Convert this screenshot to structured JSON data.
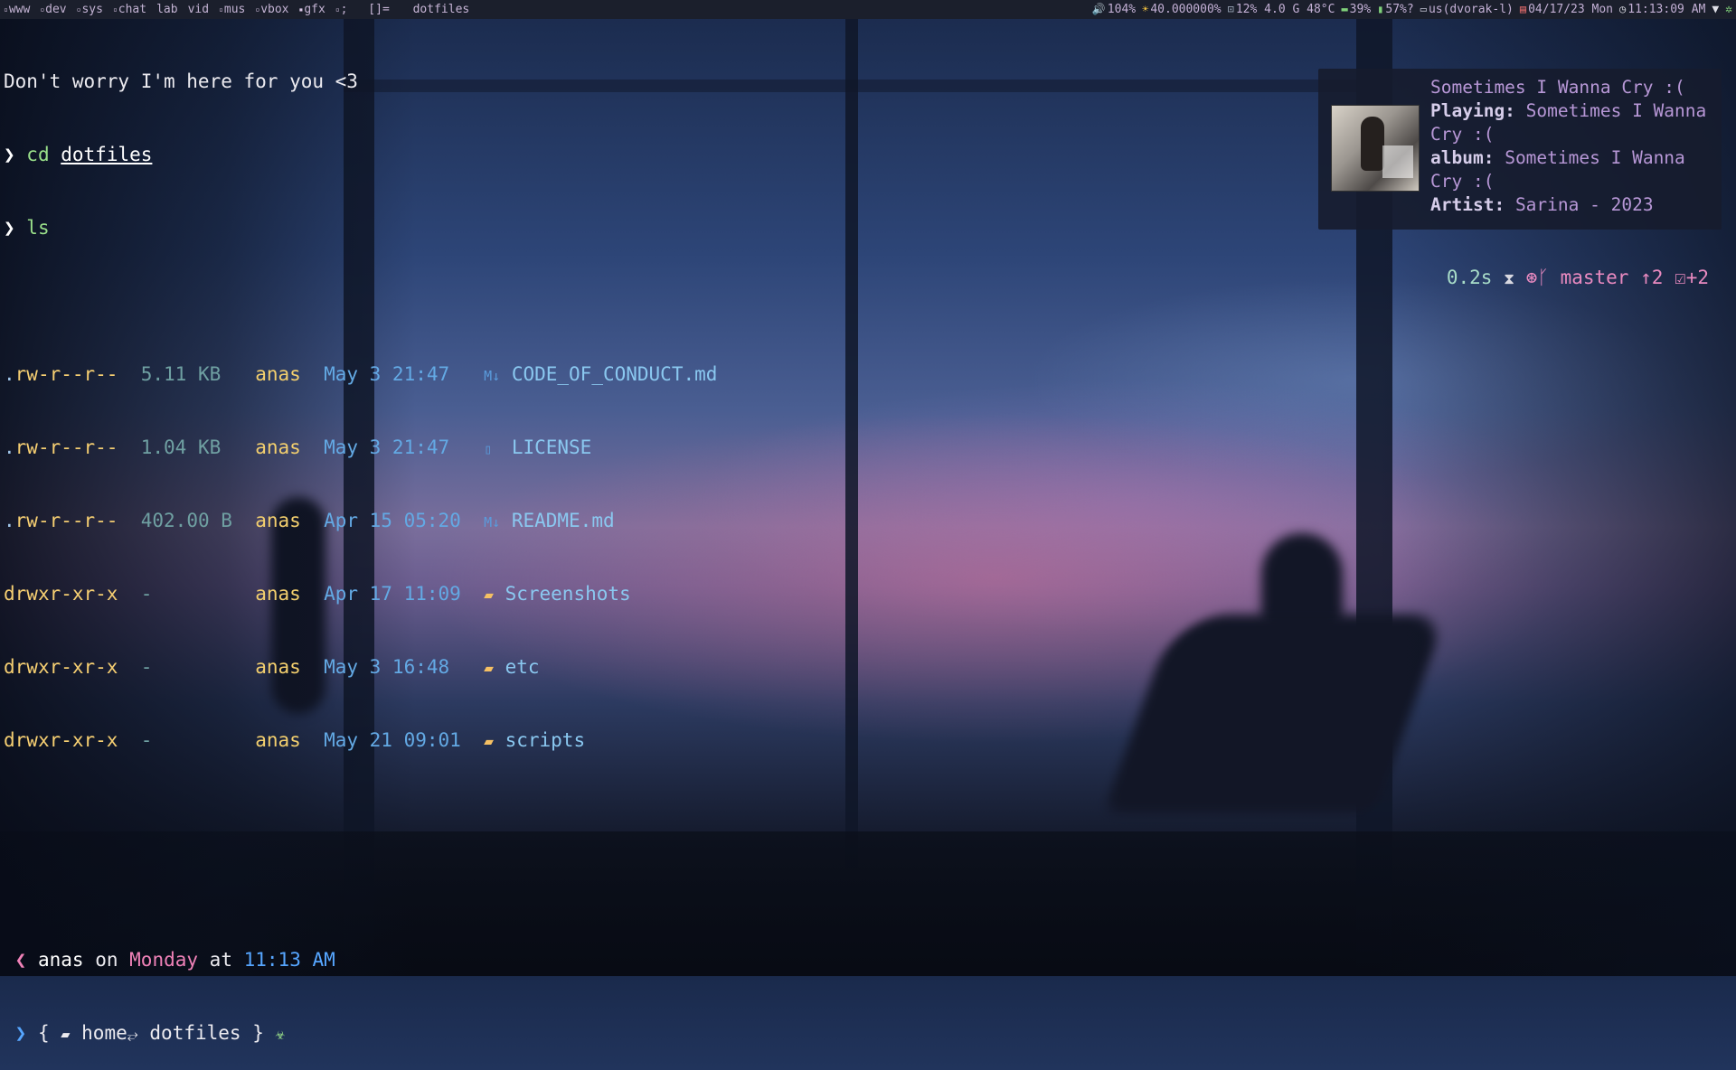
{
  "workspaces": [
    {
      "label": "www",
      "dot": true
    },
    {
      "label": "dev",
      "dot": true
    },
    {
      "label": "sys",
      "dot": true
    },
    {
      "label": "chat",
      "dot": true
    },
    {
      "label": "lab",
      "dot": false
    },
    {
      "label": "vid",
      "dot": false
    },
    {
      "label": "mus",
      "dot": true
    },
    {
      "label": "vbox",
      "dot": true
    },
    {
      "label": "gfx",
      "dot": true
    },
    {
      "label": ";",
      "dot": true
    }
  ],
  "topbar": {
    "layout": "[]=",
    "window_title": "dotfiles",
    "volume": "104%",
    "brightness": "40.000000%",
    "cpu": "12% 4.0 G 48°C",
    "memory": "39%",
    "battery": "57%?",
    "keyboard": "us(dvorak-l)",
    "date": "04/17/23 Mon",
    "time": "11:13:09 AM"
  },
  "terminal": {
    "greeting": "Don't worry I'm here for you <3",
    "cmd1": "cd",
    "cmd1_arg": "dotfiles",
    "cmd2": "ls",
    "files": [
      {
        "perm_type": ".",
        "perm": "rw-r--r--",
        "size": "5.11 KB",
        "owner": "anas",
        "date": "May 3 21:47",
        "icon": "markdown-icon",
        "name": "CODE_OF_CONDUCT.md"
      },
      {
        "perm_type": ".",
        "perm": "rw-r--r--",
        "size": "1.04 KB",
        "owner": "anas",
        "date": "May 3 21:47",
        "icon": "file-icon",
        "name": "LICENSE"
      },
      {
        "perm_type": ".",
        "perm": "rw-r--r--",
        "size": "402.00 B",
        "owner": "anas",
        "date": "Apr 15 05:20",
        "icon": "markdown-icon",
        "name": "README.md"
      },
      {
        "perm_type": "d",
        "perm": "rwxr-xr-x",
        "size": "-",
        "owner": "anas",
        "date": "Apr 17 11:09",
        "icon": "folder-icon",
        "name": "Screenshots"
      },
      {
        "perm_type": "d",
        "perm": "rwxr-xr-x",
        "size": "-",
        "owner": "anas",
        "date": "May 3 16:48",
        "icon": "folder-icon",
        "name": "etc"
      },
      {
        "perm_type": "d",
        "perm": "rwxr-xr-x",
        "size": "-",
        "owner": "anas",
        "date": "May 21 09:01",
        "icon": "folder-icon",
        "name": "scripts"
      }
    ],
    "prompt_user": "anas",
    "prompt_on": "on",
    "prompt_day": "Monday",
    "prompt_at": "at",
    "prompt_time": "11:13 AM",
    "path_home": "home",
    "path_dir": "dotfiles",
    "exec_time": "0.2s",
    "git_branch": "master",
    "git_ahead": "↑2",
    "git_staged": "+2"
  },
  "music": {
    "title": "Sometimes I Wanna Cry :(",
    "playing_label": "Playing:",
    "playing": "Sometimes I Wanna Cry :(",
    "album_label": "album:",
    "album": "Sometimes I Wanna Cry :(",
    "artist_label": "Artist:",
    "artist": "Sarina - 2023"
  }
}
